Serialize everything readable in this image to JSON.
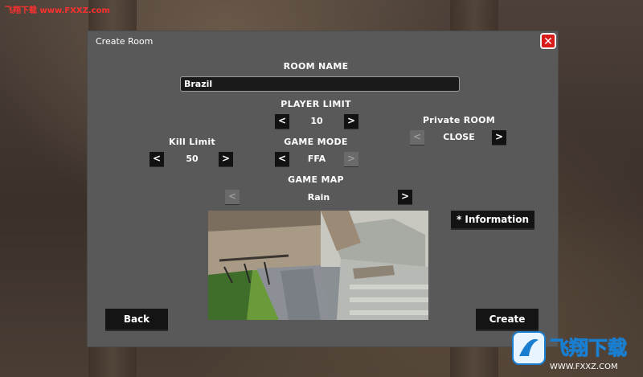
{
  "watermark": {
    "top_text": "飞翔下载 www.FXXZ.com",
    "logo_text": "飞翔下载",
    "logo_url": "WWW.FXXZ.COM"
  },
  "dialog": {
    "title": "Create Room",
    "room_name_label": "ROOM NAME",
    "room_name_value": "Brazil",
    "player_limit_label": "PLAYER LIMIT",
    "player_limit_value": "10",
    "private_room_label": "Private ROOM",
    "private_room_value": "CLOSE",
    "kill_limit_label": "Kill Limit",
    "kill_limit_value": "50",
    "game_mode_label": "GAME MODE",
    "game_mode_value": "FFA",
    "game_map_label": "GAME MAP",
    "game_map_value": "Rain",
    "information_label": "* Information",
    "back_label": "Back",
    "create_label": "Create",
    "prev_glyph": "<",
    "next_glyph": ">",
    "close_glyph": "✕"
  }
}
